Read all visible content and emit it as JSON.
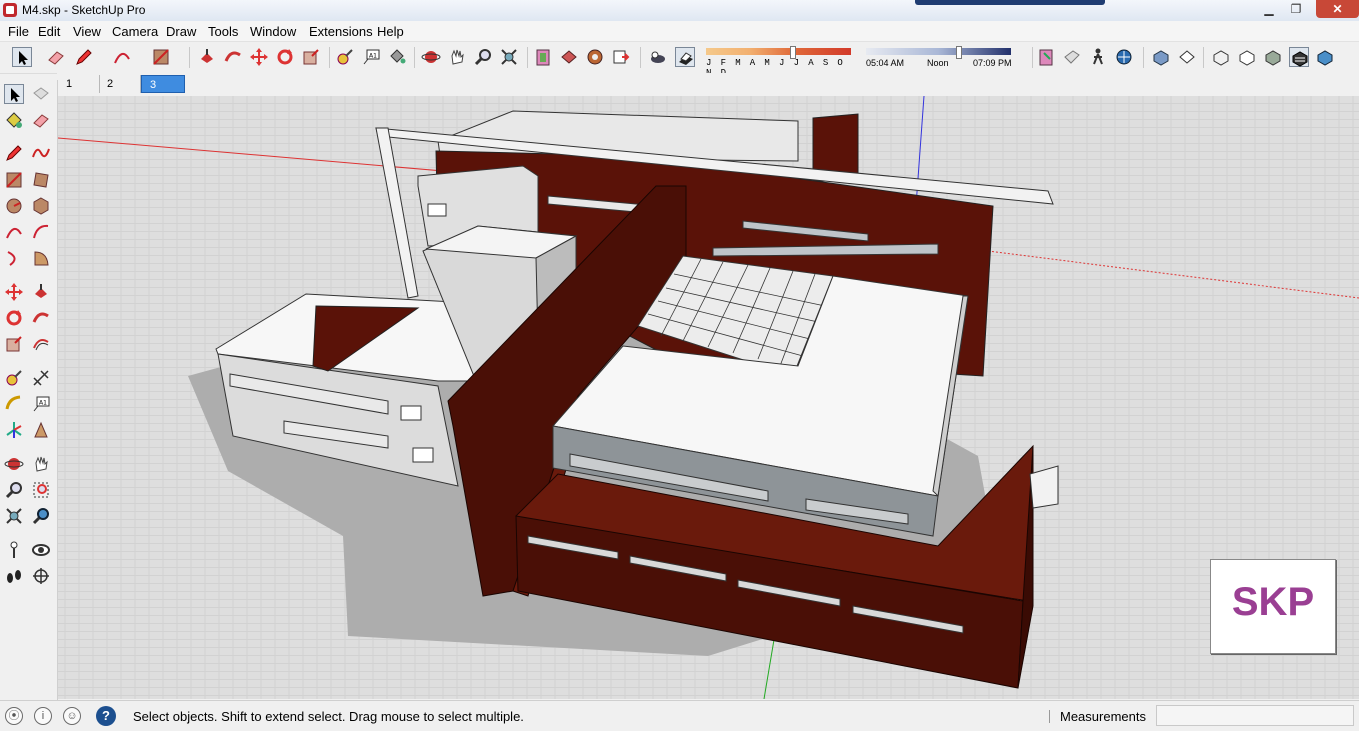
{
  "window": {
    "title": "M4.skp - SketchUp Pro",
    "minimize": "▁",
    "restore": "❐",
    "close": "✕"
  },
  "menu": [
    "File",
    "Edit",
    "View",
    "Camera",
    "Draw",
    "Tools",
    "Window",
    "Extensions",
    "Help"
  ],
  "toolbar": {
    "months": "J F M A M J J A S O N D",
    "time_start": "05:04 AM",
    "time_mid": "Noon",
    "time_end": "07:09 PM"
  },
  "scenes": [
    "1",
    "2",
    "3"
  ],
  "active_scene": "3",
  "viewport": {
    "badge": "SKP"
  },
  "status": {
    "message": "Select objects. Shift to extend select. Drag mouse to select multiple.",
    "help": "?",
    "measurements_label": "Measurements",
    "measurements_value": ""
  },
  "colors": {
    "accent": "#3f8ce0",
    "brick": "#5a1208",
    "badge_text": "#9a3f93"
  }
}
